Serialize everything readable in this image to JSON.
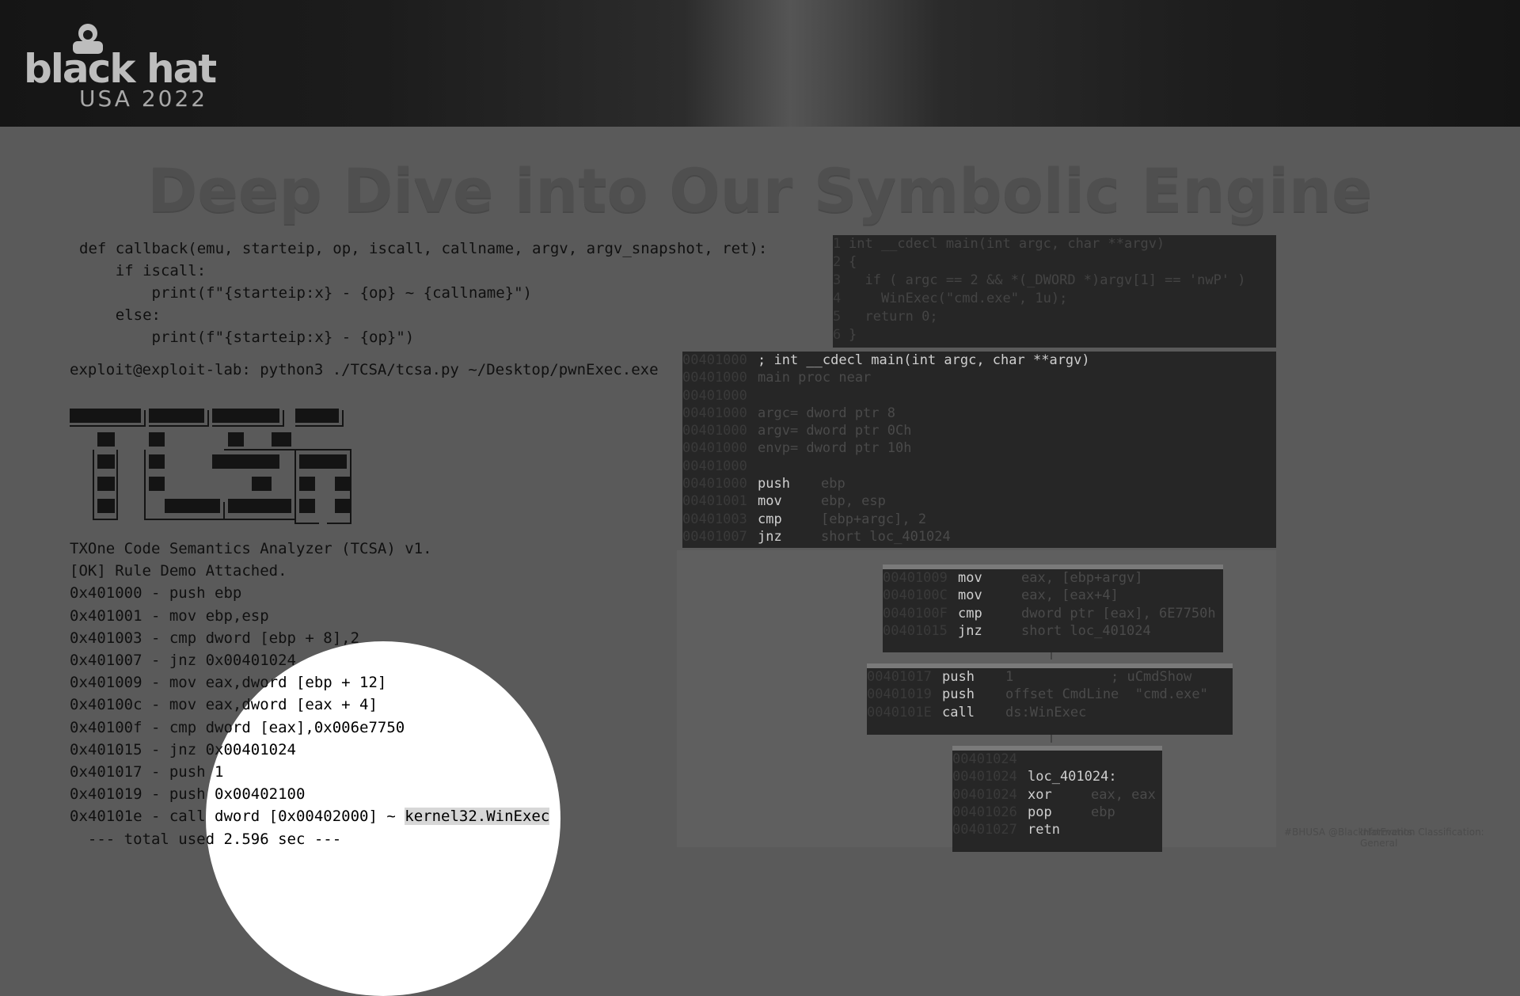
{
  "header": {
    "logo_word": "black hat",
    "logo_sub": "USA 2022"
  },
  "title": "Deep Dive into Our Symbolic Engine",
  "code_lines": [
    "def callback(emu, starteip, op, iscall, callname, argv, argv_snapshot, ret):",
    "    if iscall:",
    "        print(f\"{starteip:x} - {op} ~ {callname}\")",
    "    else:",
    "        print(f\"{starteip:x} - {op}\")"
  ],
  "terminal": {
    "command": "exploit@exploit-lab: python3 ./TCSA/tcsa.py ~/Desktop/pwnExec.exe",
    "banner_text": "TCSA",
    "lines": [
      "TXOne Code Semantics Analyzer (TCSA) v1.",
      "[OK] Rule Demo Attached.",
      "0x401000 - push ebp",
      "0x401001 - mov ebp,esp",
      "0x401003 - cmp dword [ebp + 8],2",
      "0x401007 - jnz 0x00401024",
      "0x401009 - mov eax,dword [ebp + 12]",
      "0x40100c - mov eax,dword [eax + 4]",
      "0x40100f - cmp dword [eax],0x006e7750",
      "0x401015 - jnz 0x00401024",
      "0x401017 - push 1",
      "0x401019 - push 0x00402100"
    ],
    "call_line_prefix": "0x40101e - call dword [0x00402000] ~ ",
    "call_line_highlight": "kernel32.WinExec",
    "total": "  --- total used 2.596 sec ---"
  },
  "decompiled": [
    {
      "n": "1",
      "t": "int __cdecl main(int argc, char **argv)"
    },
    {
      "n": "2",
      "t": "{"
    },
    {
      "n": "3",
      "t": "  if ( argc == 2 && *(_DWORD *)argv[1] == 'nwP' )"
    },
    {
      "n": "4",
      "t": "    WinExec(\"cmd.exe\", 1u);"
    },
    {
      "n": "5",
      "t": "  return 0;"
    },
    {
      "n": "6",
      "t": "}"
    }
  ],
  "disasm_main": [
    {
      "a": "00401000",
      "m": "; int __cdecl main(int argc, char **argv)",
      "o": ""
    },
    {
      "a": "00401000",
      "m": "main proc near",
      "o": "",
      "dim": true
    },
    {
      "a": "00401000",
      "m": "",
      "o": ""
    },
    {
      "a": "00401000",
      "m": "argc= dword ptr",
      "o": " 8",
      "dim": true
    },
    {
      "a": "00401000",
      "m": "argv= dword ptr",
      "o": " 0Ch",
      "dim": true
    },
    {
      "a": "00401000",
      "m": "envp= dword ptr",
      "o": " 10h",
      "dim": true
    },
    {
      "a": "00401000",
      "m": "",
      "o": ""
    },
    {
      "a": "00401000",
      "m": "push",
      "o": "ebp"
    },
    {
      "a": "00401001",
      "m": "mov ",
      "o": "ebp, esp"
    },
    {
      "a": "00401003",
      "m": "cmp ",
      "o": "[ebp+argc], 2"
    },
    {
      "a": "00401007",
      "m": "jnz ",
      "o": "short loc_401024"
    }
  ],
  "block1": [
    {
      "a": "00401009",
      "m": "mov",
      "o": "eax, [ebp+argv]"
    },
    {
      "a": "0040100C",
      "m": "mov",
      "o": "eax, [eax+4]"
    },
    {
      "a": "0040100F",
      "m": "cmp",
      "o": "dword ptr [eax], 6E7750h"
    },
    {
      "a": "00401015",
      "m": "jnz",
      "o": "short loc_401024"
    }
  ],
  "block2": [
    {
      "a": "00401017",
      "m": "push",
      "o": "1            ; uCmdShow"
    },
    {
      "a": "00401019",
      "m": "push",
      "o": "offset CmdLine  \"cmd.exe\""
    },
    {
      "a": "0040101E",
      "m": "call",
      "o": "ds:WinExec"
    }
  ],
  "block3": [
    {
      "a": "00401024",
      "m": "",
      "o": ""
    },
    {
      "a": "00401024",
      "m": "loc_401024:",
      "o": ""
    },
    {
      "a": "00401024",
      "m": "xor ",
      "o": "eax, eax"
    },
    {
      "a": "00401026",
      "m": "pop ",
      "o": "ebp"
    },
    {
      "a": "00401027",
      "m": "retn",
      "o": ""
    }
  ],
  "footer": {
    "left": "#BHUSA @BlackHatEvents",
    "right": "Information Classification: General"
  }
}
